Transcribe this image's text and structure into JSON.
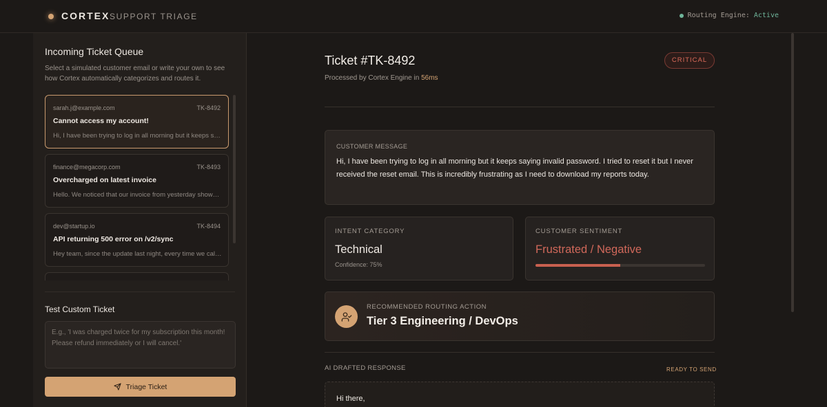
{
  "header": {
    "brand": "CORTEX",
    "brand_sub": "SUPPORT TRIAGE",
    "engine_label": "Routing Engine:",
    "engine_status": "Active"
  },
  "sidebar": {
    "title": "Incoming Ticket Queue",
    "description": "Select a simulated customer email or write your own to see how Cortex automatically categorizes and routes it.",
    "tickets": [
      {
        "email": "sarah.j@example.com",
        "id": "TK-8492",
        "subject": "Cannot access my account!",
        "preview": "Hi, I have been trying to log in all morning but it keeps saying invalid password.",
        "active": true
      },
      {
        "email": "finance@megacorp.com",
        "id": "TK-8493",
        "subject": "Overcharged on latest invoice",
        "preview": "Hello. We noticed that our invoice from yesterday shows a duplicate charge.",
        "active": false
      },
      {
        "email": "dev@startup.io",
        "id": "TK-8494",
        "subject": "API returning 500 error on /v2/sync",
        "preview": "Hey team, since the update last night, every time we call the endpoint it fails.",
        "active": false
      },
      {
        "email": "",
        "id": "",
        "subject": "",
        "preview": "",
        "active": false
      }
    ],
    "custom_title": "Test Custom Ticket",
    "custom_placeholder": "E.g., 'I was charged twice for my subscription this month! Please refund immediately or I will cancel.'",
    "triage_button": "Triage Ticket"
  },
  "main": {
    "ticket_title": "Ticket #TK-8492",
    "processed_prefix": "Processed by Cortex Engine in",
    "processed_ms": "56ms",
    "priority_badge": "CRITICAL",
    "message_label": "CUSTOMER MESSAGE",
    "message_body": "Hi, I have been trying to log in all morning but it keeps saying invalid password. I tried to reset it but I never received the reset email. This is incredibly frustrating as I need to download my reports today.",
    "intent_label": "INTENT CATEGORY",
    "intent_value": "Technical",
    "intent_confidence": "Confidence: 75%",
    "sentiment_label": "CUSTOMER SENTIMENT",
    "sentiment_value": "Frustrated / Negative",
    "sentiment_level": 0.5,
    "routing_label": "RECOMMENDED ROUTING ACTION",
    "routing_value": "Tier 3 Engineering / DevOps",
    "draft_label": "AI DRAFTED RESPONSE",
    "draft_status": "READY TO SEND",
    "draft_greeting": "Hi there,"
  },
  "colors": {
    "accent": "#d4a373",
    "critical": "#dc6b5a",
    "negative": "#c8604f",
    "active": "#6fb59a"
  }
}
